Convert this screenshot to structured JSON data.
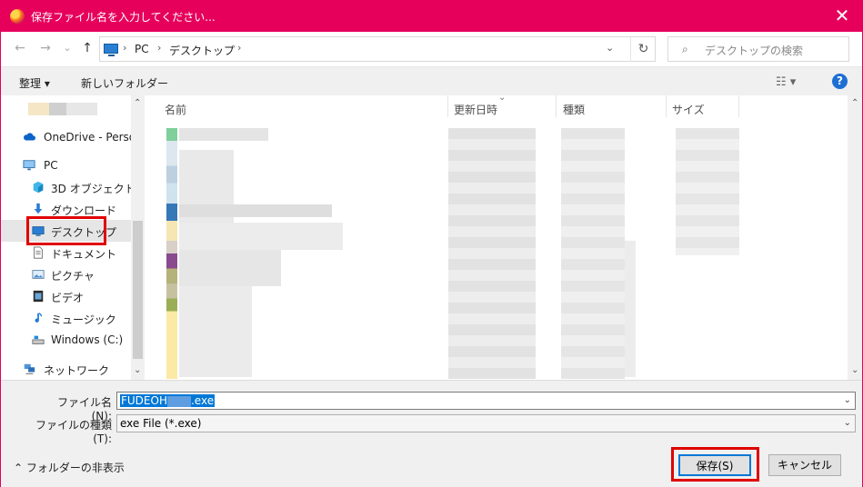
{
  "window": {
    "title": "保存ファイル名を入力してください...",
    "close_glyph": "✕"
  },
  "nav": {
    "back_glyph": "←",
    "forward_glyph": "→",
    "recent_glyph": "⌄",
    "up_glyph": "↑",
    "breadcrumb": [
      "PC",
      "デスクトップ"
    ],
    "refresh_glyph": "↻",
    "search_placeholder": "デスクトップの検索"
  },
  "toolbar": {
    "organize": "整理 ▾",
    "new_folder": "新しいフォルダー",
    "view_glyph": "☷ ▾",
    "help": "?"
  },
  "sidebar": {
    "items": [
      {
        "label": "OneDrive - Persor",
        "icon": "cloud-icon"
      },
      {
        "label": "PC",
        "icon": "computer-icon"
      },
      {
        "label": "3D オブジェクト",
        "icon": "cube-icon"
      },
      {
        "label": "ダウンロード",
        "icon": "download-icon"
      },
      {
        "label": "デスクトップ",
        "icon": "desktop-icon",
        "selected": true
      },
      {
        "label": "ドキュメント",
        "icon": "document-icon"
      },
      {
        "label": "ピクチャ",
        "icon": "picture-icon"
      },
      {
        "label": "ビデオ",
        "icon": "video-icon"
      },
      {
        "label": "ミュージック",
        "icon": "music-icon"
      },
      {
        "label": "Windows (C:)",
        "icon": "drive-icon"
      },
      {
        "label": "ネットワーク",
        "icon": "network-icon"
      }
    ]
  },
  "filelist": {
    "columns": [
      "名前",
      "更新日時",
      "種類",
      "サイズ"
    ]
  },
  "form": {
    "filename_label": "ファイル名(N):",
    "filename_value": "FUDEOH",
    "filename_ext": ".exe",
    "filetype_label": "ファイルの種類(T):",
    "filetype_value": "exe File (*.exe)",
    "hide_folders": "フォルダーの非表示",
    "save_button": "保存(S)",
    "cancel_button": "キャンセル"
  },
  "colors": {
    "titlebar": "#e6005c",
    "highlight": "#e00000",
    "accent": "#0078d7"
  }
}
